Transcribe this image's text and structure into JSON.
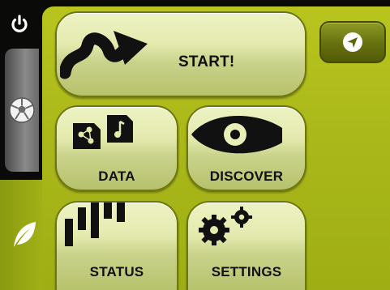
{
  "sidebar": {
    "tabs": [
      {
        "icon": "power-icon"
      },
      {
        "icon": "soccer-ball-icon"
      },
      {
        "icon": "leaf-icon"
      }
    ]
  },
  "menu": {
    "start_label": "START!",
    "data_label": "DATA",
    "discover_label": "DISCOVER",
    "status_label": "STATUS",
    "settings_label": "SETTINGS",
    "navigate_icon": "navigation-arrow-icon"
  },
  "colors": {
    "accent_green": "#aab81a",
    "tile_light": "#e4eaae",
    "sidebar_gray": "#8a8a8a",
    "background": "#0a0a08"
  }
}
